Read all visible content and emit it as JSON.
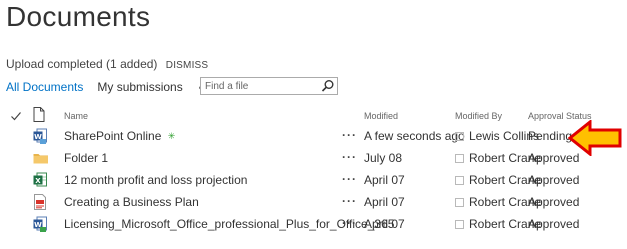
{
  "page": {
    "title": "Documents"
  },
  "upload": {
    "message": "Upload completed (1 added)",
    "dismiss": "DISMISS"
  },
  "views": {
    "all_documents": "All Documents",
    "my_submissions": "My submissions",
    "more": "•••"
  },
  "search": {
    "placeholder": "Find a file"
  },
  "columns": {
    "name": "Name",
    "modified": "Modified",
    "modified_by": "Modified By",
    "approval_status": "Approval Status"
  },
  "files": [
    {
      "name": "SharePoint Online",
      "new_badge": "✳",
      "icon": "word-doc-icon",
      "modified": "A few seconds ago",
      "modified_by": "Lewis Collins",
      "status": "Pending"
    },
    {
      "name": "Folder 1",
      "icon": "folder-icon",
      "modified": "July 08",
      "modified_by": "Robert Crane",
      "status": "Approved"
    },
    {
      "name": "12 month profit and loss projection",
      "icon": "excel-icon",
      "modified": "April 07",
      "modified_by": "Robert Crane",
      "status": "Approved"
    },
    {
      "name": "Creating a Business Plan",
      "icon": "pdf-icon",
      "modified": "April 07",
      "modified_by": "Robert Crane",
      "status": "Approved"
    },
    {
      "name": "Licensing_Microsoft_Office_professional_Plus_for_Office_365",
      "icon": "word-doc-icon",
      "modified": "April 07",
      "modified_by": "Robert Crane",
      "status": "Approved"
    }
  ],
  "colors": {
    "accent": "#0072c6",
    "arrow_fill": "#ffc000",
    "arrow_stroke": "#e00000",
    "new_badge": "#2e9e2e"
  }
}
